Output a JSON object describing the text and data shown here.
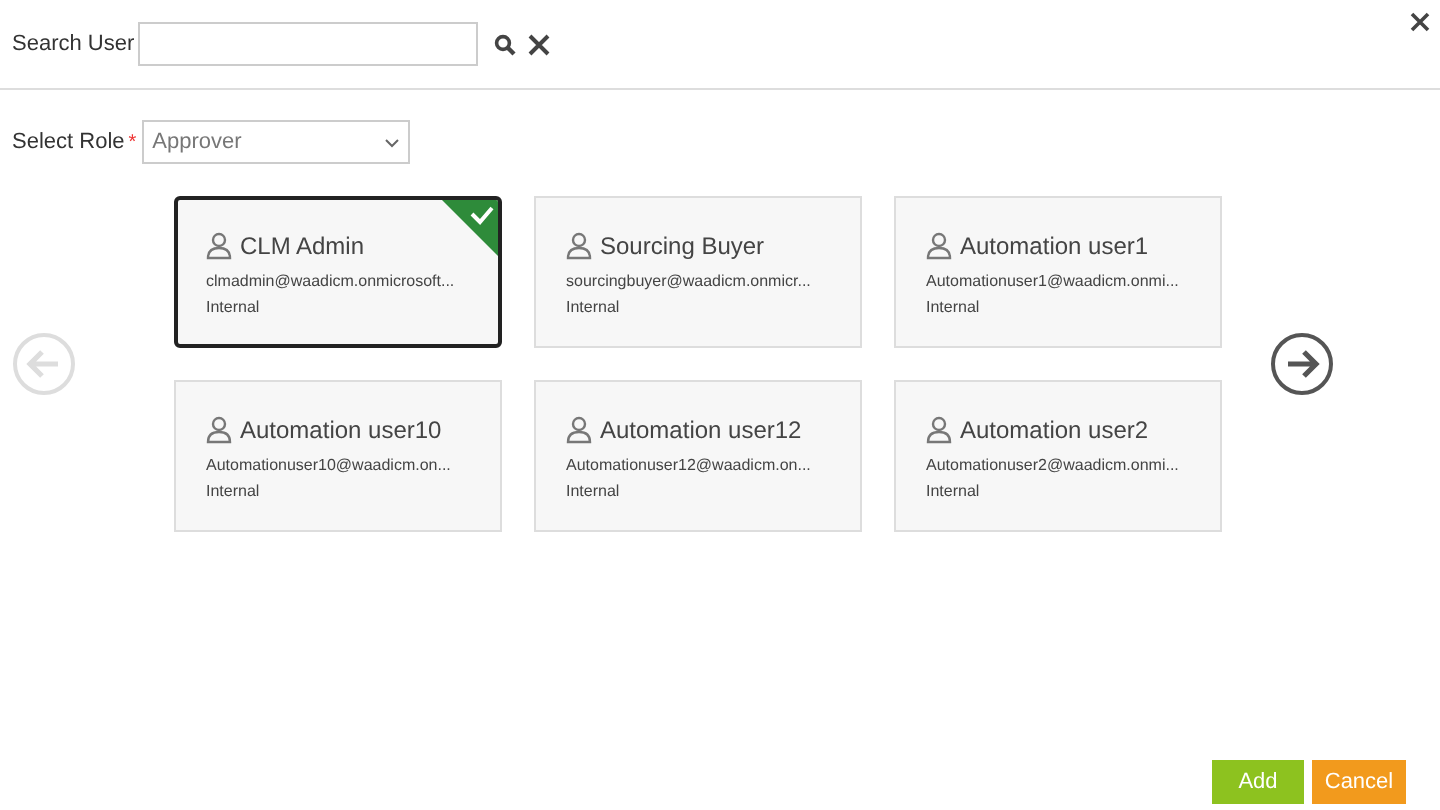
{
  "search": {
    "label": "Search User"
  },
  "role": {
    "label": "Select Role",
    "required_mark": "*",
    "value": "Approver"
  },
  "prev_button": {
    "disabled": true
  },
  "next_button": {
    "disabled": false
  },
  "users": [
    {
      "name": "CLM Admin",
      "email": "clmadmin@waadicm.onmicrosoft...",
      "type": "Internal",
      "selected": true
    },
    {
      "name": "Sourcing Buyer",
      "email": "sourcingbuyer@waadicm.onmicr...",
      "type": "Internal",
      "selected": false
    },
    {
      "name": "Automation user1",
      "email": "Automationuser1@waadicm.onmi...",
      "type": "Internal",
      "selected": false
    },
    {
      "name": "Automation user10",
      "email": "Automationuser10@waadicm.on...",
      "type": "Internal",
      "selected": false
    },
    {
      "name": "Automation user12",
      "email": "Automationuser12@waadicm.on...",
      "type": "Internal",
      "selected": false
    },
    {
      "name": "Automation user2",
      "email": "Automationuser2@waadicm.onmi...",
      "type": "Internal",
      "selected": false
    }
  ],
  "buttons": [
    {
      "label": "Add",
      "kind": "primary"
    },
    {
      "label": "Cancel",
      "kind": "secondary"
    }
  ]
}
